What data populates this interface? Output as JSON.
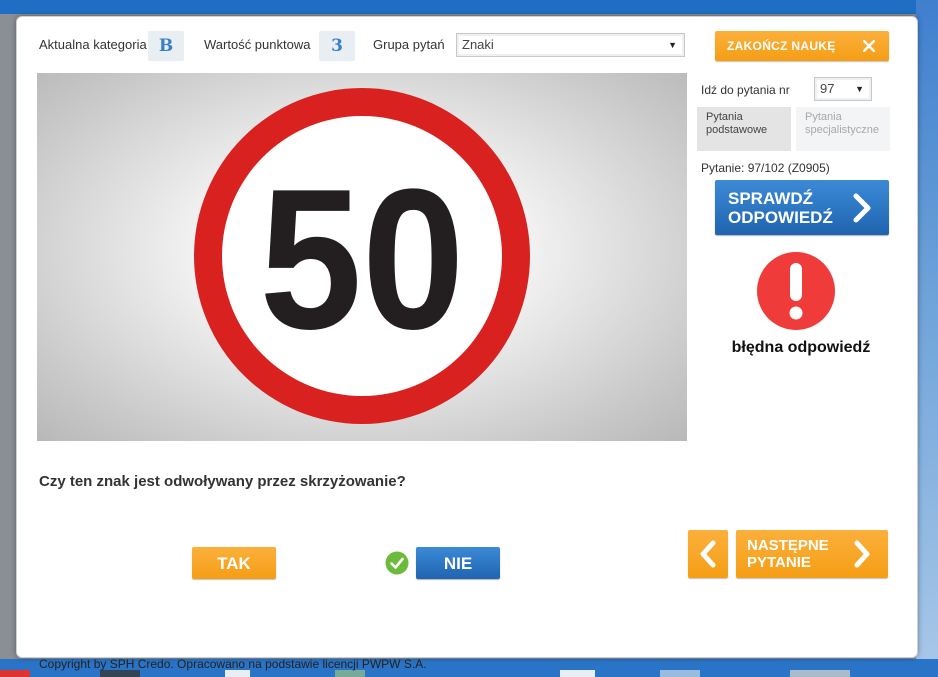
{
  "header": {
    "category_label": "Aktualna kategoria",
    "category_value": "B",
    "points_label": "Wartość punktowa",
    "points_value": "3",
    "group_label": "Grupa pytań",
    "group_value": "Znaki",
    "finish_button": "ZAKOŃCZ NAUKĘ"
  },
  "sidebar": {
    "goto_label": "Idź do pytania nr",
    "goto_value": "97",
    "tabs": [
      {
        "label": "Pytania podstawowe",
        "active": true
      },
      {
        "label": "Pytania specjalistyczne",
        "active": false
      }
    ],
    "question_counter": "Pytanie: 97/102 (Z0905)",
    "check_button": "SPRAWDŹ ODPOWIEDŹ",
    "result_text": "błędna odpowiedź"
  },
  "sign": {
    "number": "50"
  },
  "question": {
    "text": "Czy ten znak jest odwoływany przez skrzyżowanie?",
    "answers": [
      {
        "label": "TAK",
        "correct": false
      },
      {
        "label": "NIE",
        "correct": true
      }
    ]
  },
  "navigation": {
    "next_button": "NASTĘPNE PYTANIE"
  },
  "footer": {
    "copyright": "Copyright by SPH Credo. Opracowano na podstawie licencji PWPW S.A."
  },
  "colors": {
    "accent_orange": "#f7a21c",
    "accent_blue": "#2a75c4",
    "error_red": "#f03b3b",
    "correct_green": "#6dbb3a",
    "sign_red": "#d9221f"
  },
  "icons": {
    "finish": "close-x-icon",
    "check": "chevron-right-icon",
    "prev": "chevron-left-icon",
    "next": "chevron-right-icon",
    "result": "exclamation-icon",
    "correct_marker": "checkmark-icon"
  }
}
